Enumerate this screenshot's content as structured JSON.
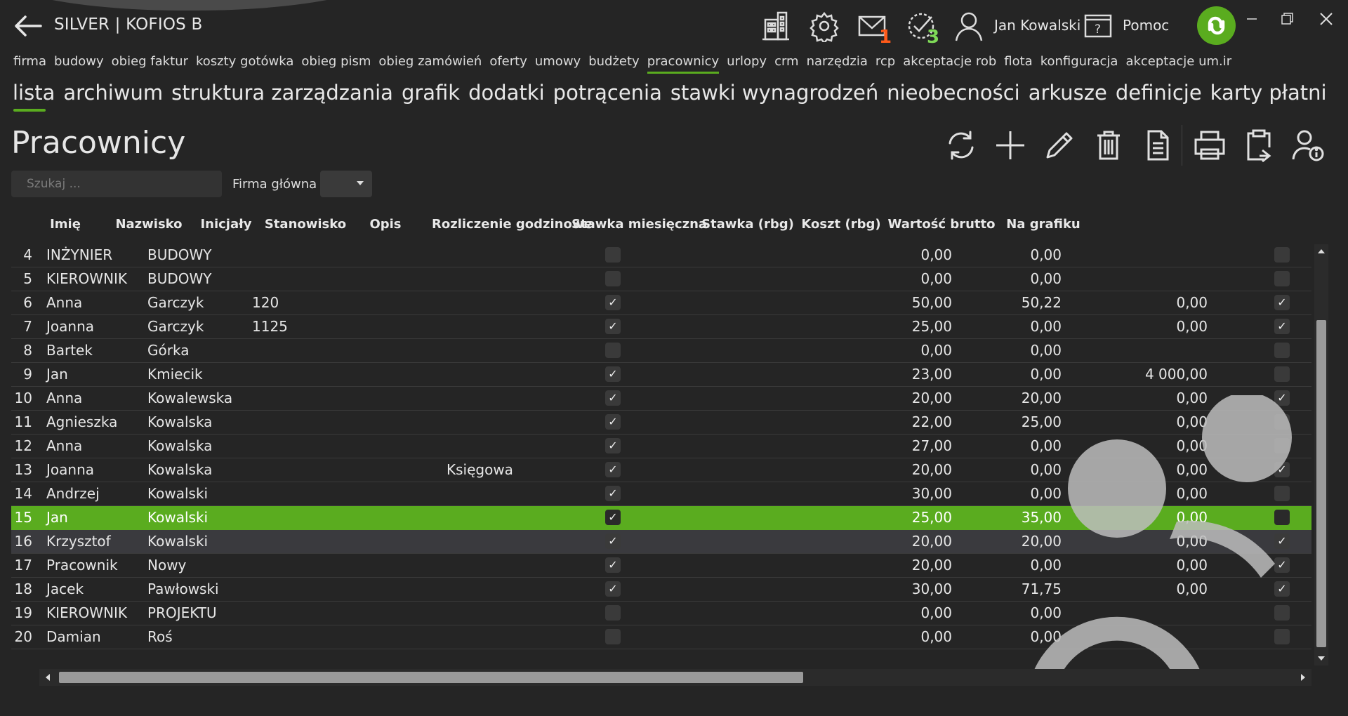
{
  "app": {
    "title": "SILVER | KOFIOS B",
    "user": "Jan Kowalski",
    "help": "Pomoc"
  },
  "badges": {
    "messages": "1",
    "tasks": "3"
  },
  "colors": {
    "accent": "#5aac1f",
    "badge_messages": "#ff5a1a",
    "badge_tasks": "#7ed957"
  },
  "main_nav": [
    "firma",
    "budowy",
    "obieg faktur",
    "koszty gotówka",
    "obieg pism",
    "obieg zamówień",
    "oferty",
    "umowy",
    "budżety",
    "pracownicy",
    "urlopy",
    "crm",
    "narzędzia",
    "rcp",
    "akceptacje rob",
    "flota",
    "konfiguracja",
    "akceptacje um.ir"
  ],
  "main_nav_active": "pracownicy",
  "sub_nav": [
    "lista",
    "archiwum",
    "struktura zarządzania",
    "grafik",
    "dodatki",
    "potrącenia",
    "stawki wynagrodzeń",
    "nieobecności",
    "arkusze",
    "definicje",
    "karty płatni"
  ],
  "sub_nav_active": "lista",
  "page": {
    "title": "Pracownicy"
  },
  "toolbar_icons": [
    "refresh-icon",
    "add-icon",
    "edit-icon",
    "delete-icon",
    "document-icon",
    "print-icon",
    "clipboard-export-icon",
    "user-info-icon"
  ],
  "search": {
    "placeholder": "Szukaj ..."
  },
  "filter": {
    "label": "Firma główna",
    "value": ""
  },
  "columns": [
    "Imię",
    "Nazwisko",
    "Inicjały",
    "Stanowisko",
    "Opis",
    "Rozliczenie godzinowe",
    "Stawka miesięczna",
    "Stawka (rbg)",
    "Koszt (rbg)",
    "Wartość brutto",
    "Na grafiku"
  ],
  "rows": [
    {
      "no": "4",
      "first": "INŻYNIER",
      "last": "BUDOWY",
      "initials": "",
      "position": "",
      "desc": "",
      "hourly": false,
      "monthly": "",
      "rate": "0,00",
      "cost": "0,00",
      "gross": "",
      "on_schedule": false
    },
    {
      "no": "5",
      "first": "KIEROWNIK",
      "last": "BUDOWY",
      "initials": "",
      "position": "",
      "desc": "",
      "hourly": false,
      "monthly": "",
      "rate": "0,00",
      "cost": "0,00",
      "gross": "",
      "on_schedule": false
    },
    {
      "no": "6",
      "first": "Anna",
      "last": "Garczyk",
      "initials": "120",
      "position": "",
      "desc": "",
      "hourly": true,
      "monthly": "",
      "rate": "50,00",
      "cost": "50,22",
      "gross": "0,00",
      "on_schedule": true
    },
    {
      "no": "7",
      "first": "Joanna",
      "last": "Garczyk",
      "initials": "1125",
      "position": "",
      "desc": "",
      "hourly": true,
      "monthly": "",
      "rate": "25,00",
      "cost": "0,00",
      "gross": "0,00",
      "on_schedule": true
    },
    {
      "no": "8",
      "first": "Bartek",
      "last": "Górka",
      "initials": "",
      "position": "",
      "desc": "",
      "hourly": false,
      "monthly": "",
      "rate": "0,00",
      "cost": "0,00",
      "gross": "",
      "on_schedule": false
    },
    {
      "no": "9",
      "first": "Jan",
      "last": "Kmiecik",
      "initials": "",
      "position": "",
      "desc": "",
      "hourly": true,
      "monthly": "",
      "rate": "23,00",
      "cost": "0,00",
      "gross": "4 000,00",
      "on_schedule": false
    },
    {
      "no": "10",
      "first": "Anna",
      "last": "Kowalewska",
      "initials": "",
      "position": "",
      "desc": "",
      "hourly": true,
      "monthly": "",
      "rate": "20,00",
      "cost": "20,00",
      "gross": "0,00",
      "on_schedule": true
    },
    {
      "no": "11",
      "first": "Agnieszka",
      "last": "Kowalska",
      "initials": "",
      "position": "",
      "desc": "",
      "hourly": true,
      "monthly": "",
      "rate": "22,00",
      "cost": "25,00",
      "gross": "0,00",
      "on_schedule": false
    },
    {
      "no": "12",
      "first": "Anna",
      "last": "Kowalska",
      "initials": "",
      "position": "",
      "desc": "",
      "hourly": true,
      "monthly": "",
      "rate": "27,00",
      "cost": "0,00",
      "gross": "0,00",
      "on_schedule": false
    },
    {
      "no": "13",
      "first": "Joanna",
      "last": "Kowalska",
      "initials": "",
      "position": "",
      "desc": "Księgowa",
      "hourly": true,
      "monthly": "",
      "rate": "20,00",
      "cost": "0,00",
      "gross": "0,00",
      "on_schedule": true
    },
    {
      "no": "14",
      "first": "Andrzej",
      "last": "Kowalski",
      "initials": "",
      "position": "",
      "desc": "",
      "hourly": true,
      "monthly": "",
      "rate": "30,00",
      "cost": "0,00",
      "gross": "0,00",
      "on_schedule": false
    },
    {
      "no": "15",
      "first": "Jan",
      "last": "Kowalski",
      "initials": "",
      "position": "",
      "desc": "",
      "hourly": true,
      "monthly": "",
      "rate": "25,00",
      "cost": "35,00",
      "gross": "0,00",
      "on_schedule": false,
      "selected": true
    },
    {
      "no": "16",
      "first": "Krzysztof",
      "last": "Kowalski",
      "initials": "",
      "position": "",
      "desc": "",
      "hourly": true,
      "monthly": "",
      "rate": "20,00",
      "cost": "20,00",
      "gross": "0,00",
      "on_schedule": true,
      "hover": true
    },
    {
      "no": "17",
      "first": "Pracownik",
      "last": "Nowy",
      "initials": "",
      "position": "",
      "desc": "",
      "hourly": true,
      "monthly": "",
      "rate": "20,00",
      "cost": "0,00",
      "gross": "0,00",
      "on_schedule": true
    },
    {
      "no": "18",
      "first": "Jacek",
      "last": "Pawłowski",
      "initials": "",
      "position": "",
      "desc": "",
      "hourly": true,
      "monthly": "",
      "rate": "30,00",
      "cost": "71,75",
      "gross": "0,00",
      "on_schedule": true
    },
    {
      "no": "19",
      "first": "KIEROWNIK",
      "last": "PROJEKTU",
      "initials": "",
      "position": "",
      "desc": "",
      "hourly": false,
      "monthly": "",
      "rate": "0,00",
      "cost": "0,00",
      "gross": "",
      "on_schedule": false
    },
    {
      "no": "20",
      "first": "Damian",
      "last": "Roś",
      "initials": "",
      "position": "",
      "desc": "",
      "hourly": false,
      "monthly": "",
      "rate": "0,00",
      "cost": "0,00",
      "gross": "",
      "on_schedule": false
    }
  ]
}
